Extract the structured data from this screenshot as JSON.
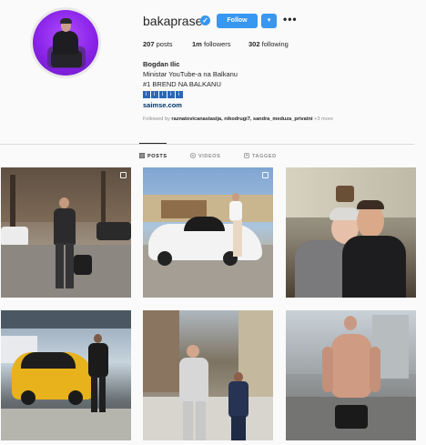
{
  "profile": {
    "username": "bakaprase",
    "verified_icon": "verified-badge-icon",
    "follow_label": "Follow",
    "dropdown_icon": "▾",
    "more_icon": "•••",
    "stats": {
      "posts_count": "207",
      "posts_label": "posts",
      "followers_count": "1m",
      "followers_label": "followers",
      "following_count": "302",
      "following_label": "following"
    },
    "full_name": "Bogdan Ilic",
    "bio_line1": "Ministar YouTube-a na Balkanu",
    "bio_line2": "#1 BREND NA BALKANU",
    "bio_line3": [
      "i",
      "i",
      "i",
      "i",
      "i"
    ],
    "website": "saimse.com",
    "followed_by_prefix": "Followed by",
    "followed_by_names": "raznatovicanastasija, nikodrugi7, sandra_meduza_privatni",
    "followed_by_more": "+3 more"
  },
  "tabs": [
    {
      "label": "POSTS",
      "icon": "grid-icon",
      "active": true
    },
    {
      "label": "VIDEOS",
      "icon": "video-icon",
      "active": false
    },
    {
      "label": "TAGGED",
      "icon": "tag-icon",
      "active": false
    }
  ],
  "colors": {
    "accent": "#3897f0",
    "background": "#fafafa",
    "text": "#262626",
    "muted": "#8e8e8e"
  }
}
